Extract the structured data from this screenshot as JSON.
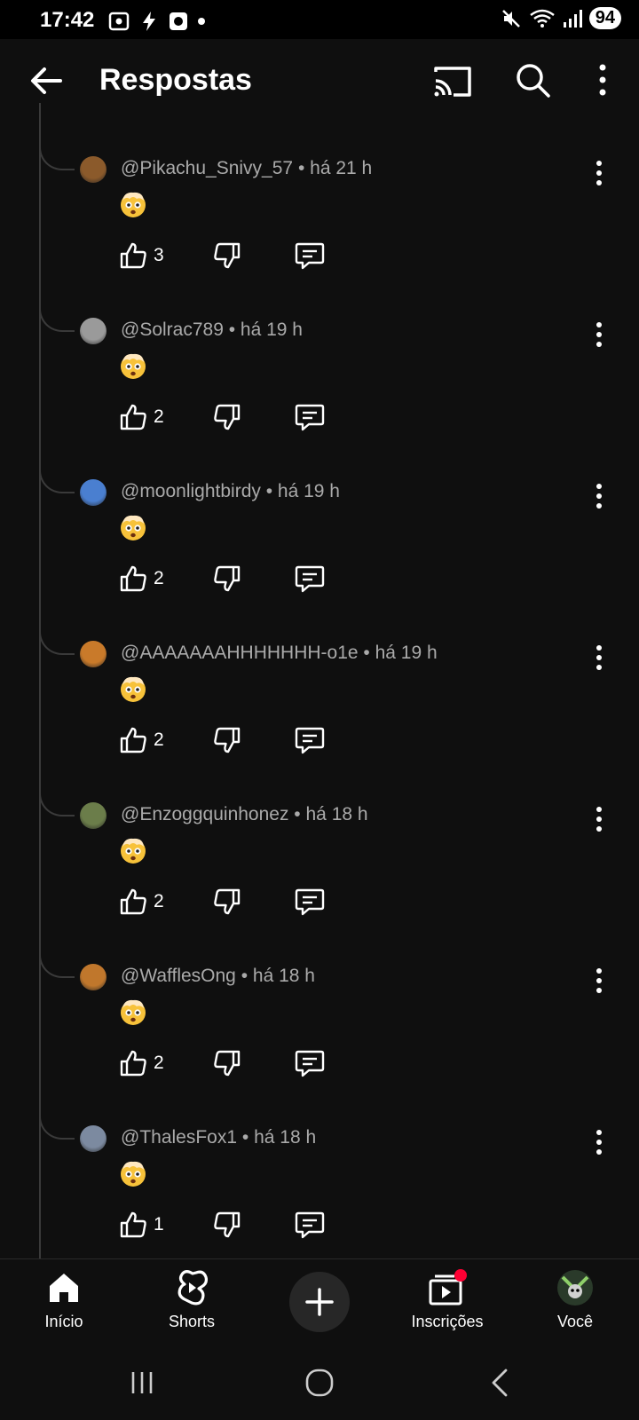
{
  "status_bar": {
    "time": "17:42",
    "battery": "94"
  },
  "header": {
    "title": "Respostas"
  },
  "replies": [
    {
      "author": "@Pikachu_Snivy_57",
      "time": "há 21 h",
      "likes": "3",
      "avatar_color": "#8b5a2b"
    },
    {
      "author": "@Solrac789",
      "time": "há 19 h",
      "likes": "2",
      "avatar_color": "#9a9a9a"
    },
    {
      "author": "@moonlightbirdy",
      "time": "há 19 h",
      "likes": "2",
      "avatar_color": "#4a7fd0"
    },
    {
      "author": "@AAAAAAAHHHHHHH-o1e",
      "time": "há 19 h",
      "likes": "2",
      "avatar_color": "#c97a2a"
    },
    {
      "author": "@Enzoggquinhonez",
      "time": "há 18 h",
      "likes": "2",
      "avatar_color": "#6b7d4a"
    },
    {
      "author": "@WafflesOng",
      "time": "há 18 h",
      "likes": "2",
      "avatar_color": "#c0772c"
    },
    {
      "author": "@ThalesFox1",
      "time": "há 18 h",
      "likes": "1",
      "avatar_color": "#7c8aa0"
    }
  ],
  "bottom_nav": {
    "home": "Início",
    "shorts": "Shorts",
    "subscriptions": "Inscrições",
    "you": "Você"
  },
  "colors": {
    "accent_red": "#ff0033",
    "background": "#0f0f0f"
  }
}
